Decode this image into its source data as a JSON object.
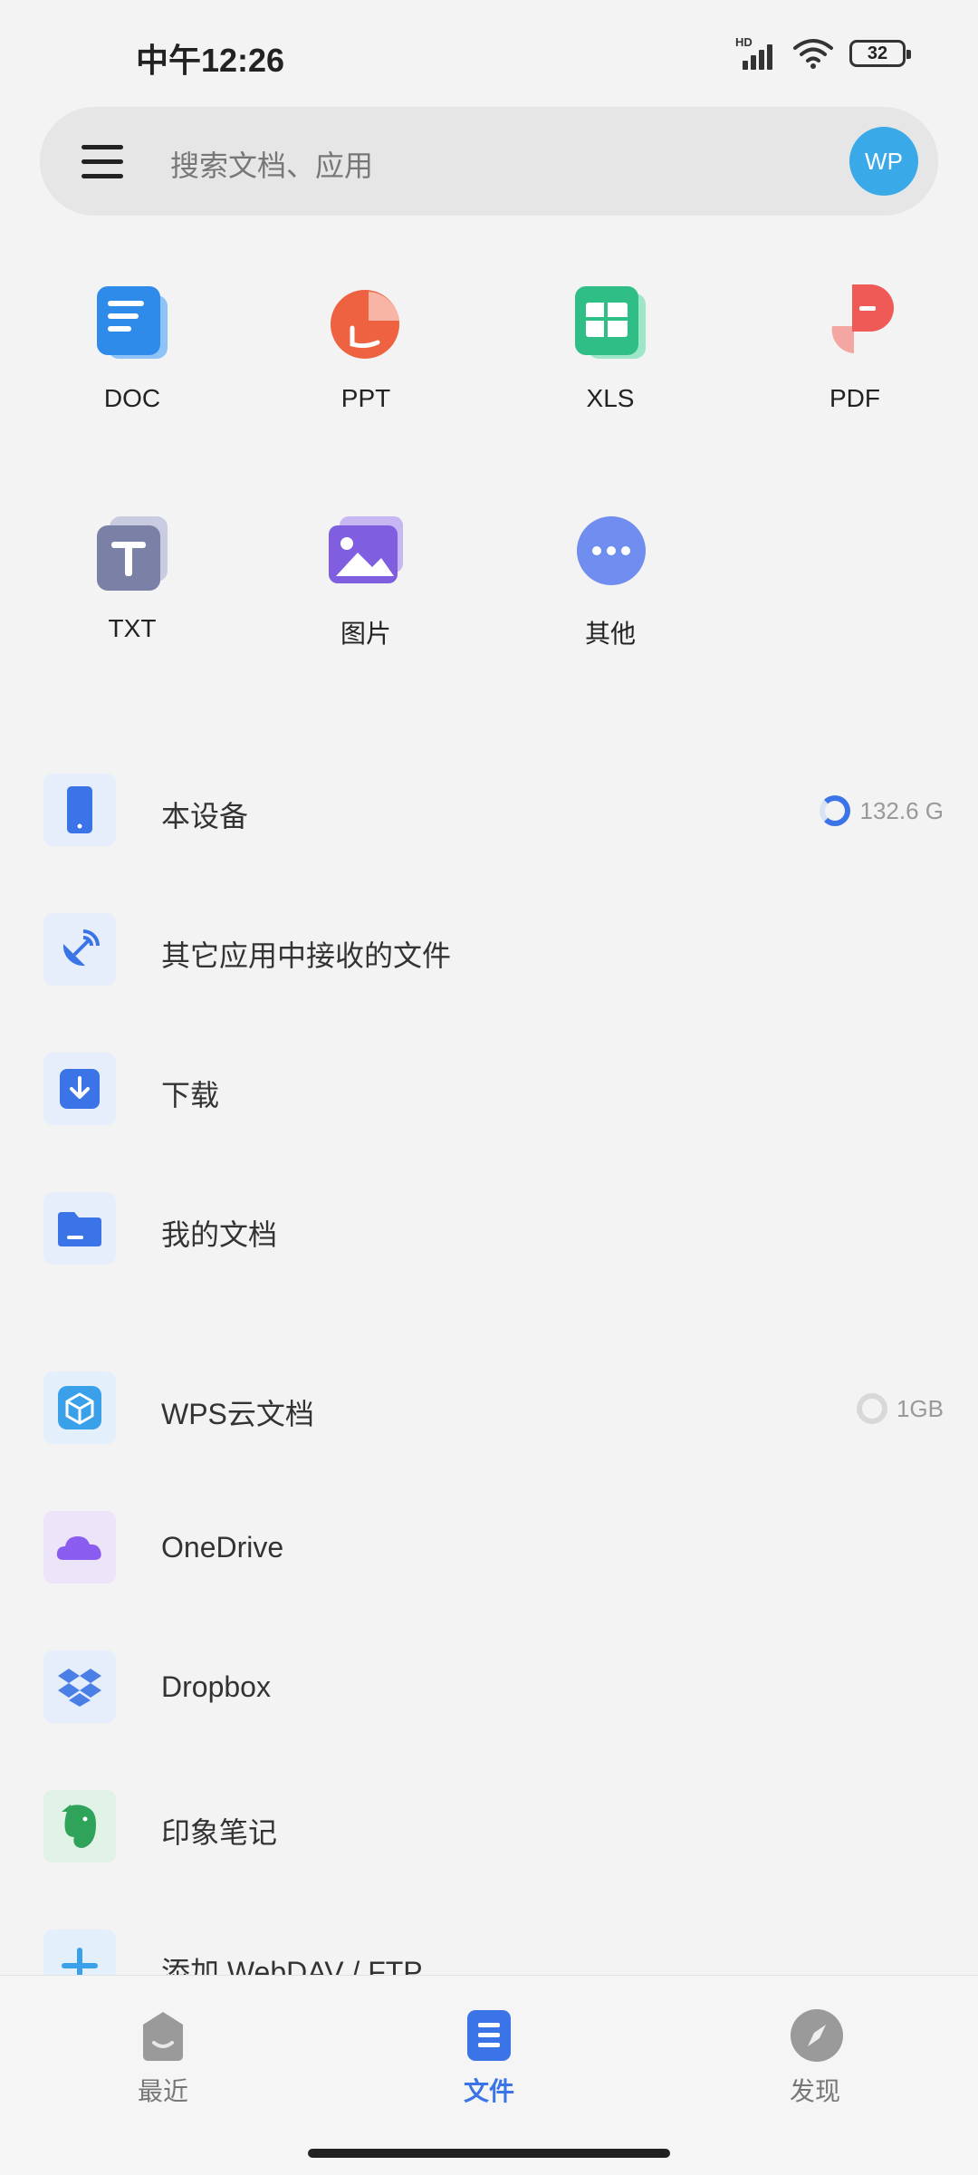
{
  "status_bar": {
    "time": "中午12:26",
    "hd": "HD",
    "battery": "32"
  },
  "search": {
    "placeholder": "搜索文档、应用",
    "avatar": "WP"
  },
  "categories": [
    {
      "label": "DOC",
      "icon": "doc-icon"
    },
    {
      "label": "PPT",
      "icon": "ppt-icon"
    },
    {
      "label": "XLS",
      "icon": "xls-icon"
    },
    {
      "label": "PDF",
      "icon": "pdf-icon"
    },
    {
      "label": "TXT",
      "icon": "txt-icon"
    },
    {
      "label": "图片",
      "icon": "image-icon"
    },
    {
      "label": "其他",
      "icon": "more-icon"
    }
  ],
  "locations": [
    {
      "title": "本设备",
      "meta": "132.6 G",
      "icon": "phone-icon"
    },
    {
      "title": "其它应用中接收的文件",
      "icon": "satellite-icon"
    },
    {
      "title": "下载",
      "icon": "download-icon"
    },
    {
      "title": "我的文档",
      "icon": "folder-icon"
    }
  ],
  "cloud": [
    {
      "title": "WPS云文档",
      "meta": "1GB",
      "icon": "cube-icon"
    },
    {
      "title": "OneDrive",
      "icon": "onedrive-icon"
    },
    {
      "title": "Dropbox",
      "icon": "dropbox-icon"
    },
    {
      "title": "印象笔记",
      "icon": "evernote-icon"
    },
    {
      "title": "添加 WebDAV / FTP",
      "icon": "plus-icon"
    }
  ],
  "nav": [
    {
      "label": "最近",
      "icon": "recent-icon"
    },
    {
      "label": "文件",
      "icon": "files-icon",
      "active": true
    },
    {
      "label": "发现",
      "icon": "compass-icon"
    }
  ],
  "colors": {
    "accent": "#3b74e6",
    "avatar": "#3aa9e8"
  }
}
